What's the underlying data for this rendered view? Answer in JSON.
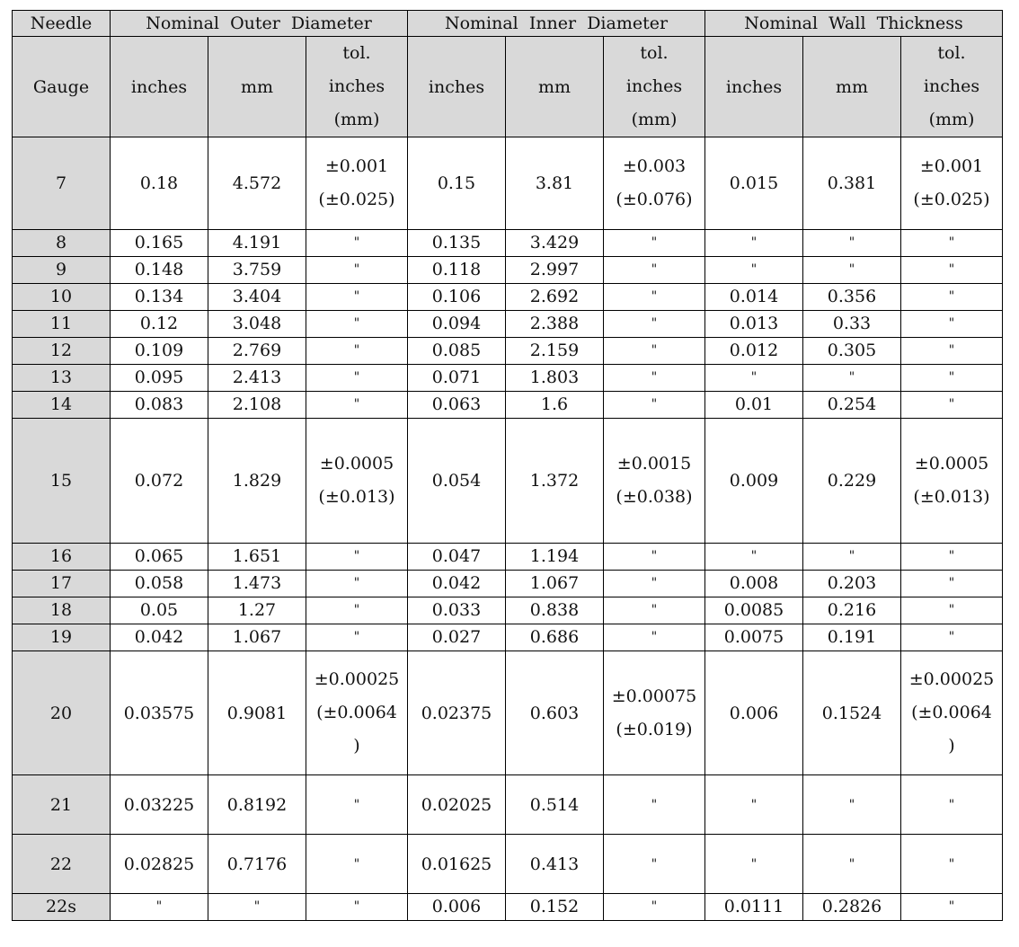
{
  "table": {
    "group_headers": [
      "Needle",
      "Nominal  Outer  Diameter",
      "Nominal  Inner  Diameter",
      "Nominal  Wall  Thickness"
    ],
    "sub_headers": {
      "gauge": "Gauge",
      "inches": "inches",
      "mm": "mm",
      "tol": [
        "tol.",
        "inches",
        "(mm)"
      ]
    },
    "rows": [
      {
        "gauge": "7",
        "od_in": "0.18",
        "od_mm": "4.572",
        "od_tol": [
          "±0.001",
          "(±0.025)"
        ],
        "id_in": "0.15",
        "id_mm": "3.81",
        "id_tol": [
          "±0.003",
          "(±0.076)"
        ],
        "wt_in": "0.015",
        "wt_mm": "0.381",
        "wt_tol": [
          "±0.001",
          "(±0.025)"
        ]
      },
      {
        "gauge": "8",
        "od_in": "0.165",
        "od_mm": "4.191",
        "od_tol": "\"",
        "id_in": "0.135",
        "id_mm": "3.429",
        "id_tol": "\"",
        "wt_in": "\"",
        "wt_mm": "\"",
        "wt_tol": "\""
      },
      {
        "gauge": "9",
        "od_in": "0.148",
        "od_mm": "3.759",
        "od_tol": "\"",
        "id_in": "0.118",
        "id_mm": "2.997",
        "id_tol": "\"",
        "wt_in": "\"",
        "wt_mm": "\"",
        "wt_tol": "\""
      },
      {
        "gauge": "10",
        "od_in": "0.134",
        "od_mm": "3.404",
        "od_tol": "\"",
        "id_in": "0.106",
        "id_mm": "2.692",
        "id_tol": "\"",
        "wt_in": "0.014",
        "wt_mm": "0.356",
        "wt_tol": "\""
      },
      {
        "gauge": "11",
        "od_in": "0.12",
        "od_mm": "3.048",
        "od_tol": "\"",
        "id_in": "0.094",
        "id_mm": "2.388",
        "id_tol": "\"",
        "wt_in": "0.013",
        "wt_mm": "0.33",
        "wt_tol": "\""
      },
      {
        "gauge": "12",
        "od_in": "0.109",
        "od_mm": "2.769",
        "od_tol": "\"",
        "id_in": "0.085",
        "id_mm": "2.159",
        "id_tol": "\"",
        "wt_in": "0.012",
        "wt_mm": "0.305",
        "wt_tol": "\""
      },
      {
        "gauge": "13",
        "od_in": "0.095",
        "od_mm": "2.413",
        "od_tol": "\"",
        "id_in": "0.071",
        "id_mm": "1.803",
        "id_tol": "\"",
        "wt_in": "\"",
        "wt_mm": "\"",
        "wt_tol": "\""
      },
      {
        "gauge": "14",
        "od_in": "0.083",
        "od_mm": "2.108",
        "od_tol": "\"",
        "id_in": "0.063",
        "id_mm": "1.6",
        "id_tol": "\"",
        "wt_in": "0.01",
        "wt_mm": "0.254",
        "wt_tol": "\""
      },
      {
        "gauge": "15",
        "od_in": "0.072",
        "od_mm": "1.829",
        "od_tol": [
          "±0.0005",
          "(±0.013)"
        ],
        "id_in": "0.054",
        "id_mm": "1.372",
        "id_tol": [
          "±0.0015",
          "(±0.038)"
        ],
        "wt_in": "0.009",
        "wt_mm": "0.229",
        "wt_tol": [
          "±0.0005",
          "(±0.013)"
        ]
      },
      {
        "gauge": "16",
        "od_in": "0.065",
        "od_mm": "1.651",
        "od_tol": "\"",
        "id_in": "0.047",
        "id_mm": "1.194",
        "id_tol": "\"",
        "wt_in": "\"",
        "wt_mm": "\"",
        "wt_tol": "\""
      },
      {
        "gauge": "17",
        "od_in": "0.058",
        "od_mm": "1.473",
        "od_tol": "\"",
        "id_in": "0.042",
        "id_mm": "1.067",
        "id_tol": "\"",
        "wt_in": "0.008",
        "wt_mm": "0.203",
        "wt_tol": "\""
      },
      {
        "gauge": "18",
        "od_in": "0.05",
        "od_mm": "1.27",
        "od_tol": "\"",
        "id_in": "0.033",
        "id_mm": "0.838",
        "id_tol": "\"",
        "wt_in": "0.0085",
        "wt_mm": "0.216",
        "wt_tol": "\""
      },
      {
        "gauge": "19",
        "od_in": "0.042",
        "od_mm": "1.067",
        "od_tol": "\"",
        "id_in": "0.027",
        "id_mm": "0.686",
        "id_tol": "\"",
        "wt_in": "0.0075",
        "wt_mm": "0.191",
        "wt_tol": "\""
      },
      {
        "gauge": "20",
        "od_in": "0.03575",
        "od_mm": "0.9081",
        "od_tol": [
          "±0.00025",
          "(±0.0064",
          ")"
        ],
        "id_in": "0.02375",
        "id_mm": "0.603",
        "id_tol": [
          "±0.00075",
          "(±0.019)"
        ],
        "wt_in": "0.006",
        "wt_mm": "0.1524",
        "wt_tol": [
          "±0.00025",
          "(±0.0064",
          ")"
        ]
      },
      {
        "gauge": "21",
        "od_in": "0.03225",
        "od_mm": "0.8192",
        "od_tol": "\"",
        "id_in": "0.02025",
        "id_mm": "0.514",
        "id_tol": "\"",
        "wt_in": "\"",
        "wt_mm": "\"",
        "wt_tol": "\""
      },
      {
        "gauge": "22",
        "od_in": "0.02825",
        "od_mm": "0.7176",
        "od_tol": "\"",
        "id_in": "0.01625",
        "id_mm": "0.413",
        "id_tol": "\"",
        "wt_in": "\"",
        "wt_mm": "\"",
        "wt_tol": "\""
      },
      {
        "gauge": "22s",
        "od_in": "\"",
        "od_mm": "\"",
        "od_tol": "\"",
        "id_in": "0.006",
        "id_mm": "0.152",
        "id_tol": "\"",
        "wt_in": "0.0111",
        "wt_mm": "0.2826",
        "wt_tol": "\""
      }
    ]
  }
}
